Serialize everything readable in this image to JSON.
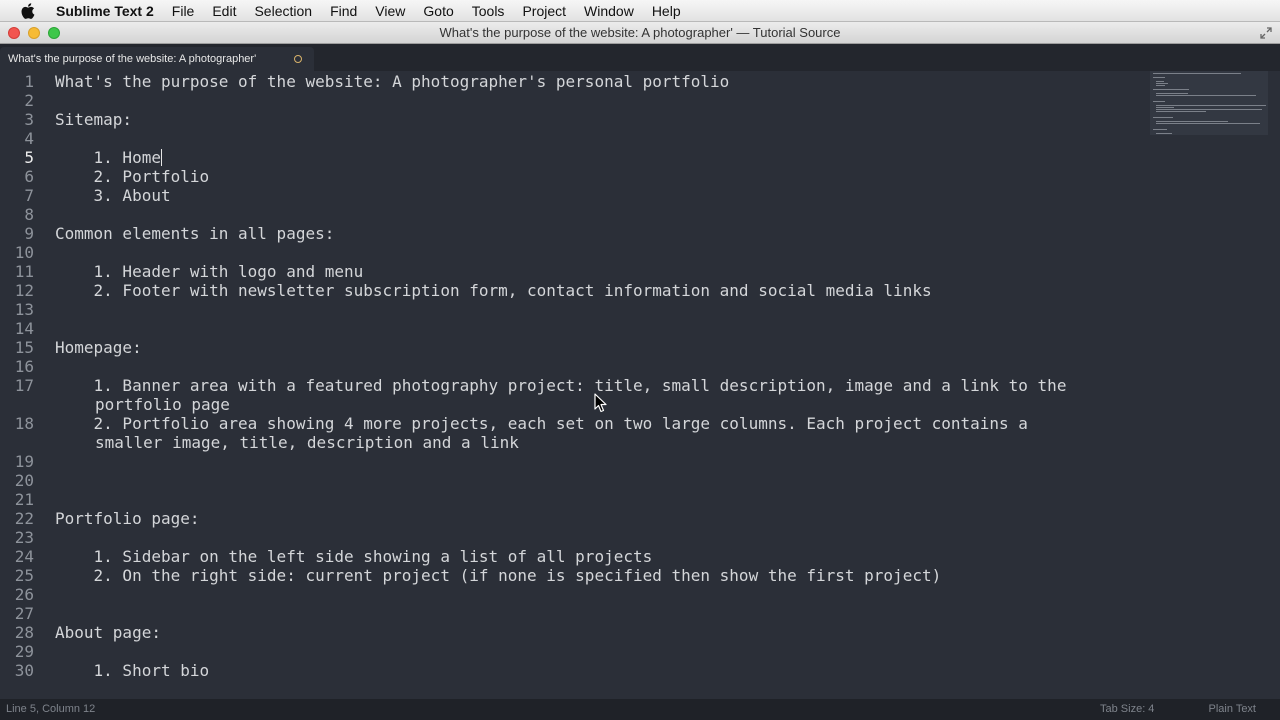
{
  "menubar": {
    "app_name": "Sublime Text 2",
    "items": [
      "File",
      "Edit",
      "Selection",
      "Find",
      "View",
      "Goto",
      "Tools",
      "Project",
      "Window",
      "Help"
    ]
  },
  "window": {
    "title": "What's the purpose of the website: A photographer' — Tutorial Source"
  },
  "tab": {
    "label": "What's the purpose of the website: A photographer'"
  },
  "editor": {
    "lines": [
      {
        "num": "1",
        "text": "What's the purpose of the website: A photographer's personal portfolio"
      },
      {
        "num": "2",
        "text": ""
      },
      {
        "num": "3",
        "text": "Sitemap:"
      },
      {
        "num": "4",
        "text": ""
      },
      {
        "num": "5",
        "text": "    1. Home"
      },
      {
        "num": "6",
        "text": "    2. Portfolio"
      },
      {
        "num": "7",
        "text": "    3. About"
      },
      {
        "num": "8",
        "text": ""
      },
      {
        "num": "9",
        "text": "Common elements in all pages:"
      },
      {
        "num": "10",
        "text": ""
      },
      {
        "num": "11",
        "text": "    1. Header with logo and menu"
      },
      {
        "num": "12",
        "text": "    2. Footer with newsletter subscription form, contact information and social media links"
      },
      {
        "num": "13",
        "text": ""
      },
      {
        "num": "14",
        "text": ""
      },
      {
        "num": "15",
        "text": "Homepage:"
      },
      {
        "num": "16",
        "text": ""
      },
      {
        "num": "17",
        "text": "    1. Banner area with a featured photography project: title, small description, image and a link to the",
        "wrap": "portfolio page"
      },
      {
        "num": "18",
        "text": "    2. Portfolio area showing 4 more projects, each set on two large columns. Each project contains a",
        "wrap": "smaller image, title, description and a link"
      },
      {
        "num": "19",
        "text": ""
      },
      {
        "num": "20",
        "text": ""
      },
      {
        "num": "21",
        "text": ""
      },
      {
        "num": "22",
        "text": "Portfolio page:"
      },
      {
        "num": "23",
        "text": ""
      },
      {
        "num": "24",
        "text": "    1. Sidebar on the left side showing a list of all projects"
      },
      {
        "num": "25",
        "text": "    2. On the right side: current project (if none is specified then show the first project)"
      },
      {
        "num": "26",
        "text": ""
      },
      {
        "num": "27",
        "text": ""
      },
      {
        "num": "28",
        "text": "About page:"
      },
      {
        "num": "29",
        "text": ""
      },
      {
        "num": "30",
        "text": "    1. Short bio"
      }
    ],
    "current_line": 5
  },
  "statusbar": {
    "position": "Line 5, Column 12",
    "tab_size": "Tab Size: 4",
    "syntax": "Plain Text"
  },
  "icons": {
    "menu_logo": "apple-icon",
    "fullscreen": "fullscreen-icon",
    "tab_modified": "unsaved-dot-icon",
    "cursor": "mouse-pointer-icon"
  }
}
